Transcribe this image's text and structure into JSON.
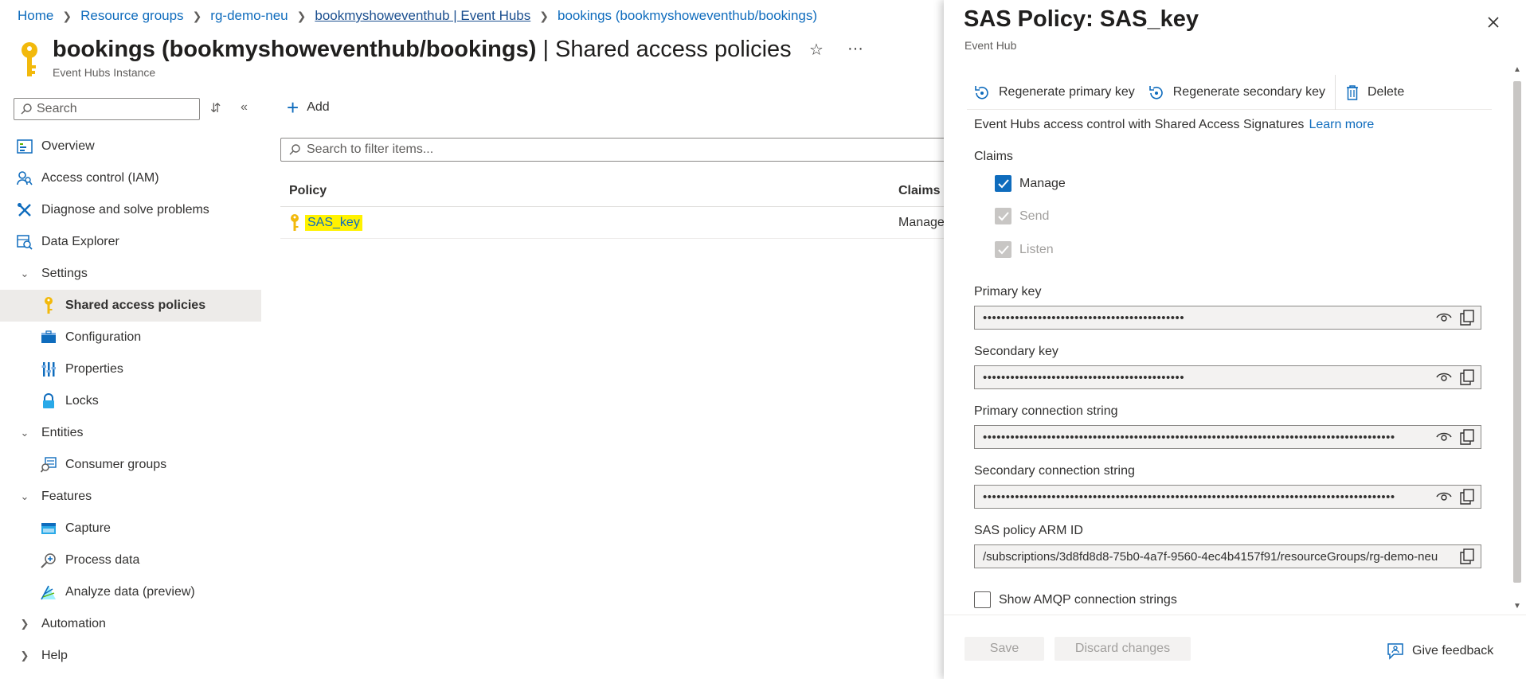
{
  "breadcrumb": {
    "items": [
      "Home",
      "Resource groups",
      "rg-demo-neu",
      "bookmyshoweventhub | Event Hubs",
      "bookings (bookmyshoweventhub/bookings)"
    ]
  },
  "header": {
    "title_bold": "bookings (bookmyshoweventhub/bookings)",
    "title_rest": " | Shared access policies",
    "subtitle": "Event Hubs Instance",
    "favorite_icon": "star",
    "more_label": "···"
  },
  "sidebar": {
    "search_placeholder": "Search",
    "items": [
      {
        "label": "Overview",
        "icon": "overview-icon"
      },
      {
        "label": "Access control (IAM)",
        "icon": "iam-icon"
      },
      {
        "label": "Diagnose and solve problems",
        "icon": "wrench-icon"
      },
      {
        "label": "Data Explorer",
        "icon": "data-explorer-icon"
      },
      {
        "label": "Settings",
        "icon": "chevron-down"
      },
      {
        "label": "Shared access policies",
        "icon": "key-icon"
      },
      {
        "label": "Configuration",
        "icon": "configuration-icon"
      },
      {
        "label": "Properties",
        "icon": "properties-icon"
      },
      {
        "label": "Locks",
        "icon": "lock-icon"
      },
      {
        "label": "Entities",
        "icon": "chevron-down"
      },
      {
        "label": "Consumer groups",
        "icon": "consumer-groups-icon"
      },
      {
        "label": "Features",
        "icon": "chevron-down"
      },
      {
        "label": "Capture",
        "icon": "capture-icon"
      },
      {
        "label": "Process data",
        "icon": "process-data-icon"
      },
      {
        "label": "Analyze data (preview)",
        "icon": "analyze-data-icon"
      },
      {
        "label": "Automation",
        "icon": "chevron-right"
      },
      {
        "label": "Help",
        "icon": "chevron-right"
      }
    ]
  },
  "main": {
    "add_label": "Add",
    "filter_placeholder": "Search to filter items...",
    "columns": [
      "Policy",
      "Claims"
    ],
    "rows": [
      {
        "policy": "SAS_key",
        "claims": "Manage"
      }
    ]
  },
  "panel": {
    "title": "SAS Policy: SAS_key",
    "subtitle": "Event Hub",
    "toolbar": {
      "regen_primary": "Regenerate primary key",
      "regen_secondary": "Regenerate secondary key",
      "delete": "Delete"
    },
    "info_text": "Event Hubs access control with Shared Access Signatures",
    "learn_more": "Learn more",
    "claims_label": "Claims",
    "claims": [
      {
        "label": "Manage",
        "checked": true,
        "disabled": false
      },
      {
        "label": "Send",
        "checked": true,
        "disabled": true
      },
      {
        "label": "Listen",
        "checked": true,
        "disabled": true
      }
    ],
    "primary_key_label": "Primary key",
    "primary_key_value": "••••••••••••••••••••••••••••••••••••••••••••",
    "secondary_key_label": "Secondary key",
    "secondary_key_value": "••••••••••••••••••••••••••••••••••••••••••••",
    "primary_conn_label": "Primary connection string",
    "primary_conn_value": "••••••••••••••••••••••••••••••••••••••••••••••••••••••••••••••••••••••••••••••••••••••••••",
    "secondary_conn_label": "Secondary connection string",
    "secondary_conn_value": "••••••••••••••••••••••••••••••••••••••••••••••••••••••••••••••••••••••••••••••••••••••••••",
    "arm_id_label": "SAS policy ARM ID",
    "arm_id_value": "/subscriptions/3d8fd8d8-75b0-4a7f-9560-4ec4b4157f91/resourceGroups/rg-demo-neu",
    "amqp_label": "Show AMQP connection strings",
    "save_label": "Save",
    "discard_label": "Discard changes",
    "feedback_label": "Give feedback"
  },
  "colors": {
    "accent": "#0f6cbd",
    "highlight": "#fff200",
    "key_gold": "#f2b90c"
  }
}
